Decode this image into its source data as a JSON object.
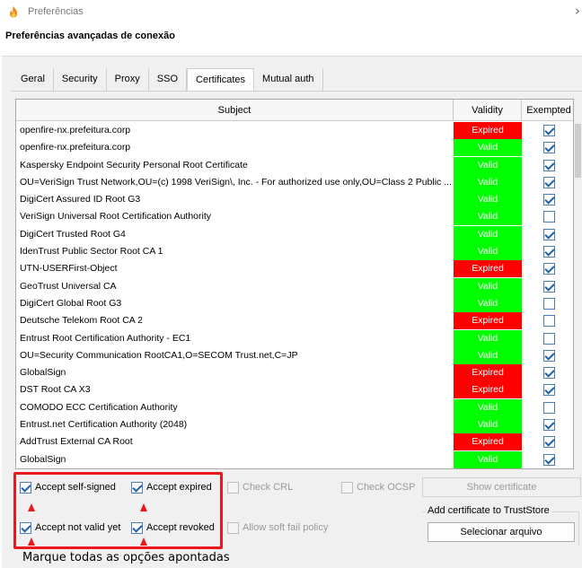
{
  "window": {
    "title": "Preferências",
    "heading": "Preferências avançadas de conexão"
  },
  "tabs": [
    {
      "label": "Geral",
      "active": false
    },
    {
      "label": "Security",
      "active": false
    },
    {
      "label": "Proxy",
      "active": false
    },
    {
      "label": "SSO",
      "active": false
    },
    {
      "label": "Certificates",
      "active": true
    },
    {
      "label": "Mutual auth",
      "active": false
    }
  ],
  "table": {
    "headers": {
      "subject": "Subject",
      "validity": "Validity",
      "exempted": "Exempted"
    },
    "rows": [
      {
        "subject": "openfire-nx.prefeitura.corp",
        "validity": "Expired",
        "exempted": true
      },
      {
        "subject": "openfire-nx.prefeitura.corp",
        "validity": "Valid",
        "exempted": true
      },
      {
        "subject": "Kaspersky Endpoint Security Personal Root Certificate",
        "validity": "Valid",
        "exempted": true
      },
      {
        "subject": "OU=VeriSign Trust Network,OU=(c) 1998 VeriSign\\, Inc. - For authorized use only,OU=Class 2 Public ...",
        "validity": "Valid",
        "exempted": true
      },
      {
        "subject": "DigiCert Assured ID Root G3",
        "validity": "Valid",
        "exempted": true
      },
      {
        "subject": "VeriSign Universal Root Certification Authority",
        "validity": "Valid",
        "exempted": false
      },
      {
        "subject": "DigiCert Trusted Root G4",
        "validity": "Valid",
        "exempted": true
      },
      {
        "subject": "IdenTrust Public Sector Root CA 1",
        "validity": "Valid",
        "exempted": true
      },
      {
        "subject": "UTN-USERFirst-Object",
        "validity": "Expired",
        "exempted": true
      },
      {
        "subject": "GeoTrust Universal CA",
        "validity": "Valid",
        "exempted": true
      },
      {
        "subject": "DigiCert Global Root G3",
        "validity": "Valid",
        "exempted": false
      },
      {
        "subject": "Deutsche Telekom Root CA 2",
        "validity": "Expired",
        "exempted": false
      },
      {
        "subject": "Entrust Root Certification Authority - EC1",
        "validity": "Valid",
        "exempted": false
      },
      {
        "subject": "OU=Security Communication RootCA1,O=SECOM Trust.net,C=JP",
        "validity": "Valid",
        "exempted": true
      },
      {
        "subject": "GlobalSign",
        "validity": "Expired",
        "exempted": true
      },
      {
        "subject": "DST Root CA X3",
        "validity": "Expired",
        "exempted": true
      },
      {
        "subject": "COMODO ECC Certification Authority",
        "validity": "Valid",
        "exempted": false
      },
      {
        "subject": "Entrust.net Certification Authority (2048)",
        "validity": "Valid",
        "exempted": true
      },
      {
        "subject": "AddTrust External CA Root",
        "validity": "Expired",
        "exempted": true
      },
      {
        "subject": "GlobalSign",
        "validity": "Valid",
        "exempted": true
      }
    ]
  },
  "options": {
    "accept_self_signed": {
      "label": "Accept self-signed",
      "checked": true
    },
    "accept_expired": {
      "label": "Accept expired",
      "checked": true
    },
    "check_crl": {
      "label": "Check CRL",
      "checked": false
    },
    "check_ocsp": {
      "label": "Check OCSP",
      "checked": false
    },
    "accept_not_valid_yet": {
      "label": "Accept not valid yet",
      "checked": true
    },
    "accept_revoked": {
      "label": "Accept revoked",
      "checked": true
    },
    "allow_soft_fail": {
      "label": "Allow soft fail policy",
      "checked": false
    }
  },
  "buttons": {
    "show_certificate": "Show certificate",
    "select_file": "Selecionar arquivo"
  },
  "truststore_group": {
    "title": "Add certificate to TrustStore"
  },
  "annotation": {
    "caption": "Marque todas as opções apontadas"
  },
  "colors": {
    "valid": "#00ff00",
    "expired": "#ff0000",
    "highlight": "#e8181c",
    "check": "#1f5fae"
  }
}
